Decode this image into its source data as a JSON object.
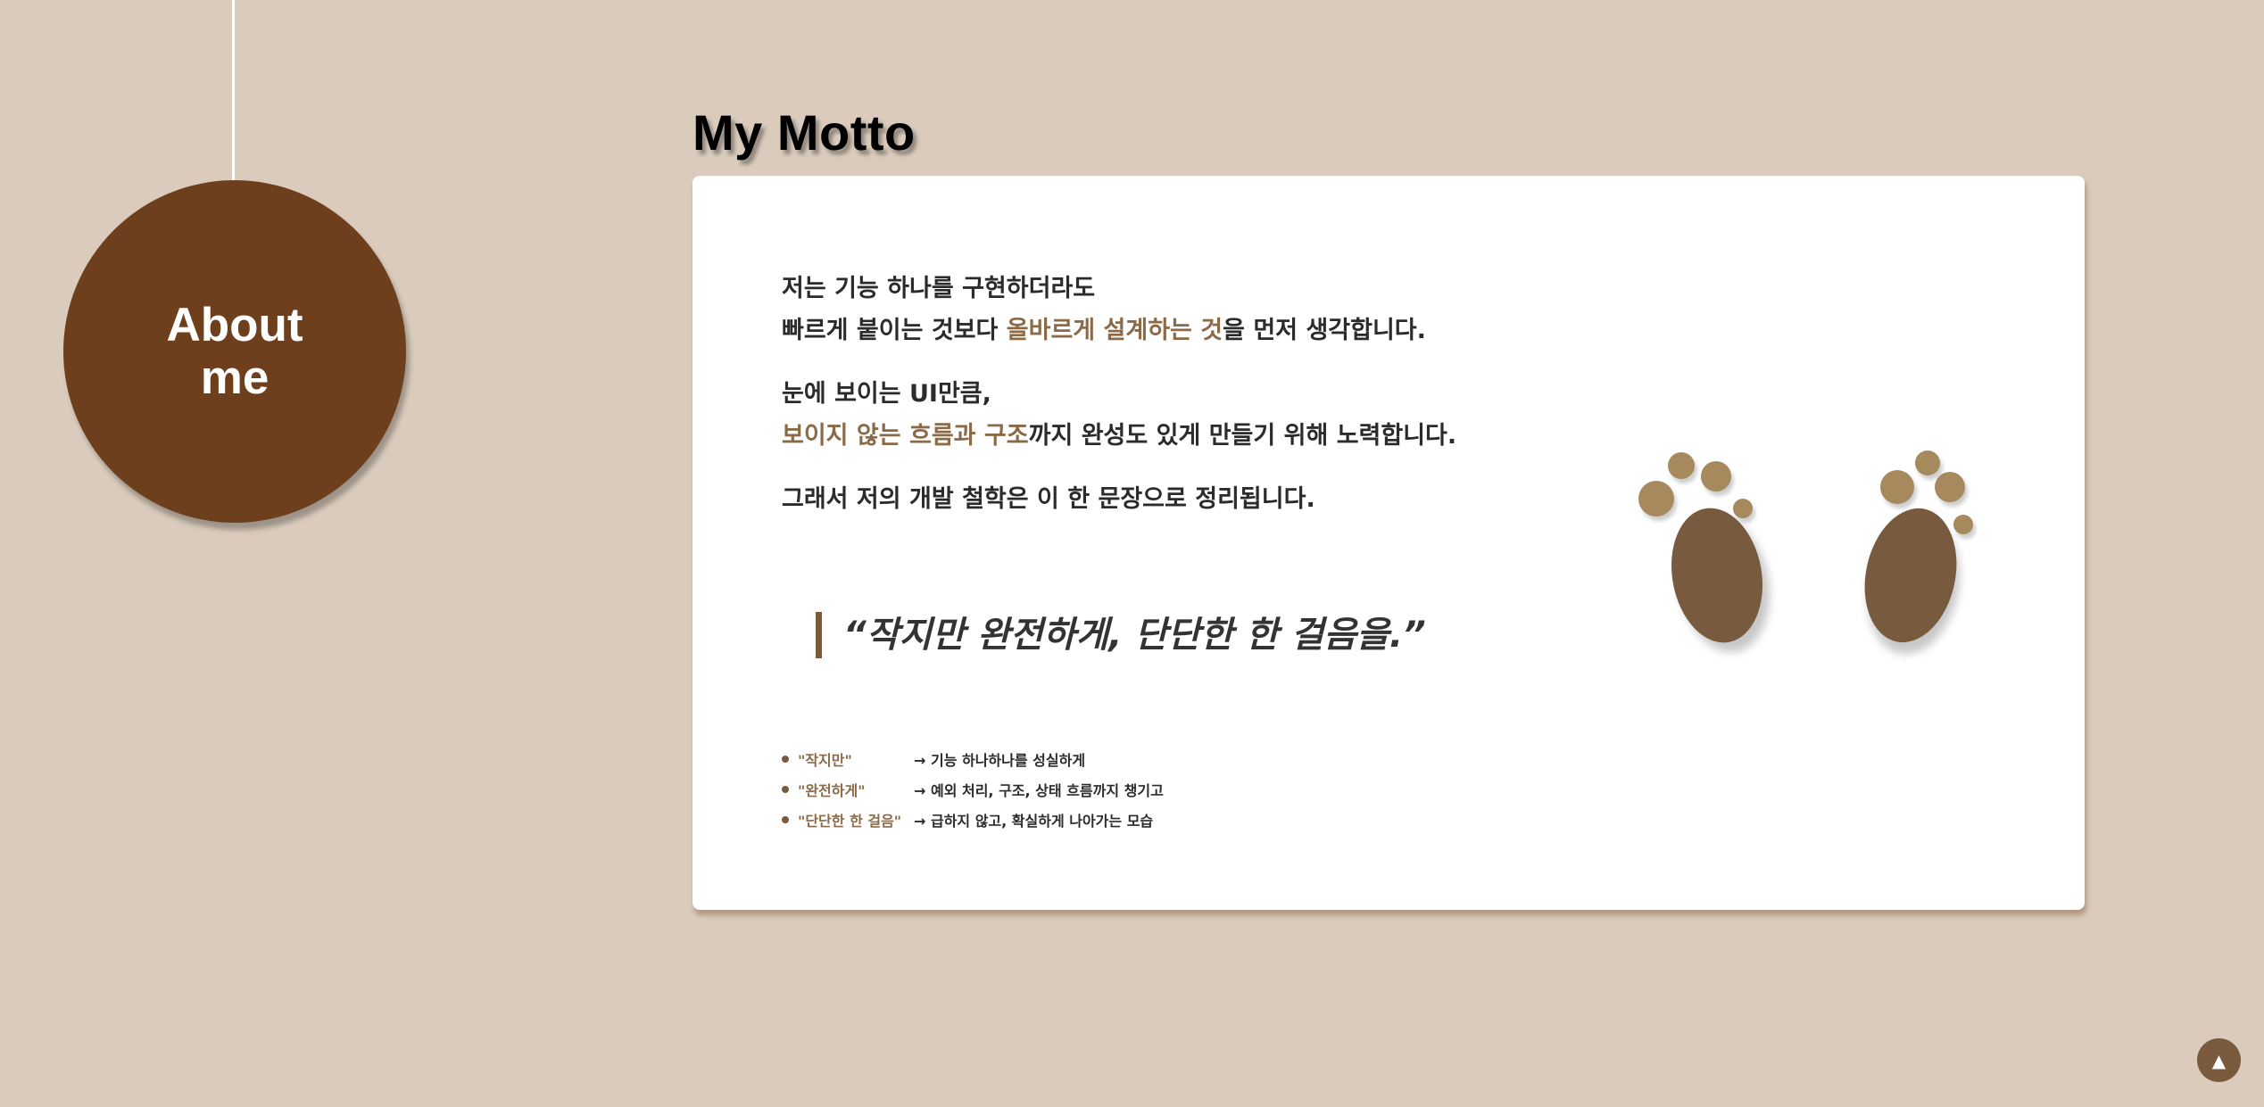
{
  "sidebar": {
    "badge_label": "About me"
  },
  "motto": {
    "title": "My Motto",
    "paragraphs": [
      {
        "line1": "저는 기능 하나를 구현하더라도",
        "line2_before": "빠르게 붙이는 것보다 ",
        "line2_highlight": "올바르게 설계하는 것",
        "line2_after": "을 먼저 생각합니다."
      },
      {
        "line1": "눈에 보이는 UI만큼,",
        "line2_highlight": "보이지 않는 흐름과 구조",
        "line2_after": "까지 완성도 있게 만들기 위해 노력합니다."
      },
      {
        "line1": "그래서 저의 개발 철학은 이 한 문장으로 정리됩니다."
      }
    ],
    "quote": "“작지만 완전하게, 단단한 한 걸음을.”",
    "points": [
      {
        "key": "\"작지만\"",
        "desc": "→ 기능 하나하나를 성실하게"
      },
      {
        "key": "\"완전하게\"",
        "desc": "→ 예외 처리, 구조, 상태 흐름까지 챙기고"
      },
      {
        "key": "\"단단한 한 걸음\"",
        "desc": "→ 급하지 않고, 확실하게 나아가는 모습"
      }
    ],
    "illustration": "footprints-icon"
  },
  "scroll_top": {
    "icon": "arrow-up-icon",
    "glyph": "▲"
  },
  "colors": {
    "background": "#dacbbc",
    "badge": "#6e3f1c",
    "accent": "#8b6a47",
    "card": "#ffffff",
    "footprint": "#785b3e",
    "toe": "#a68a5d"
  }
}
